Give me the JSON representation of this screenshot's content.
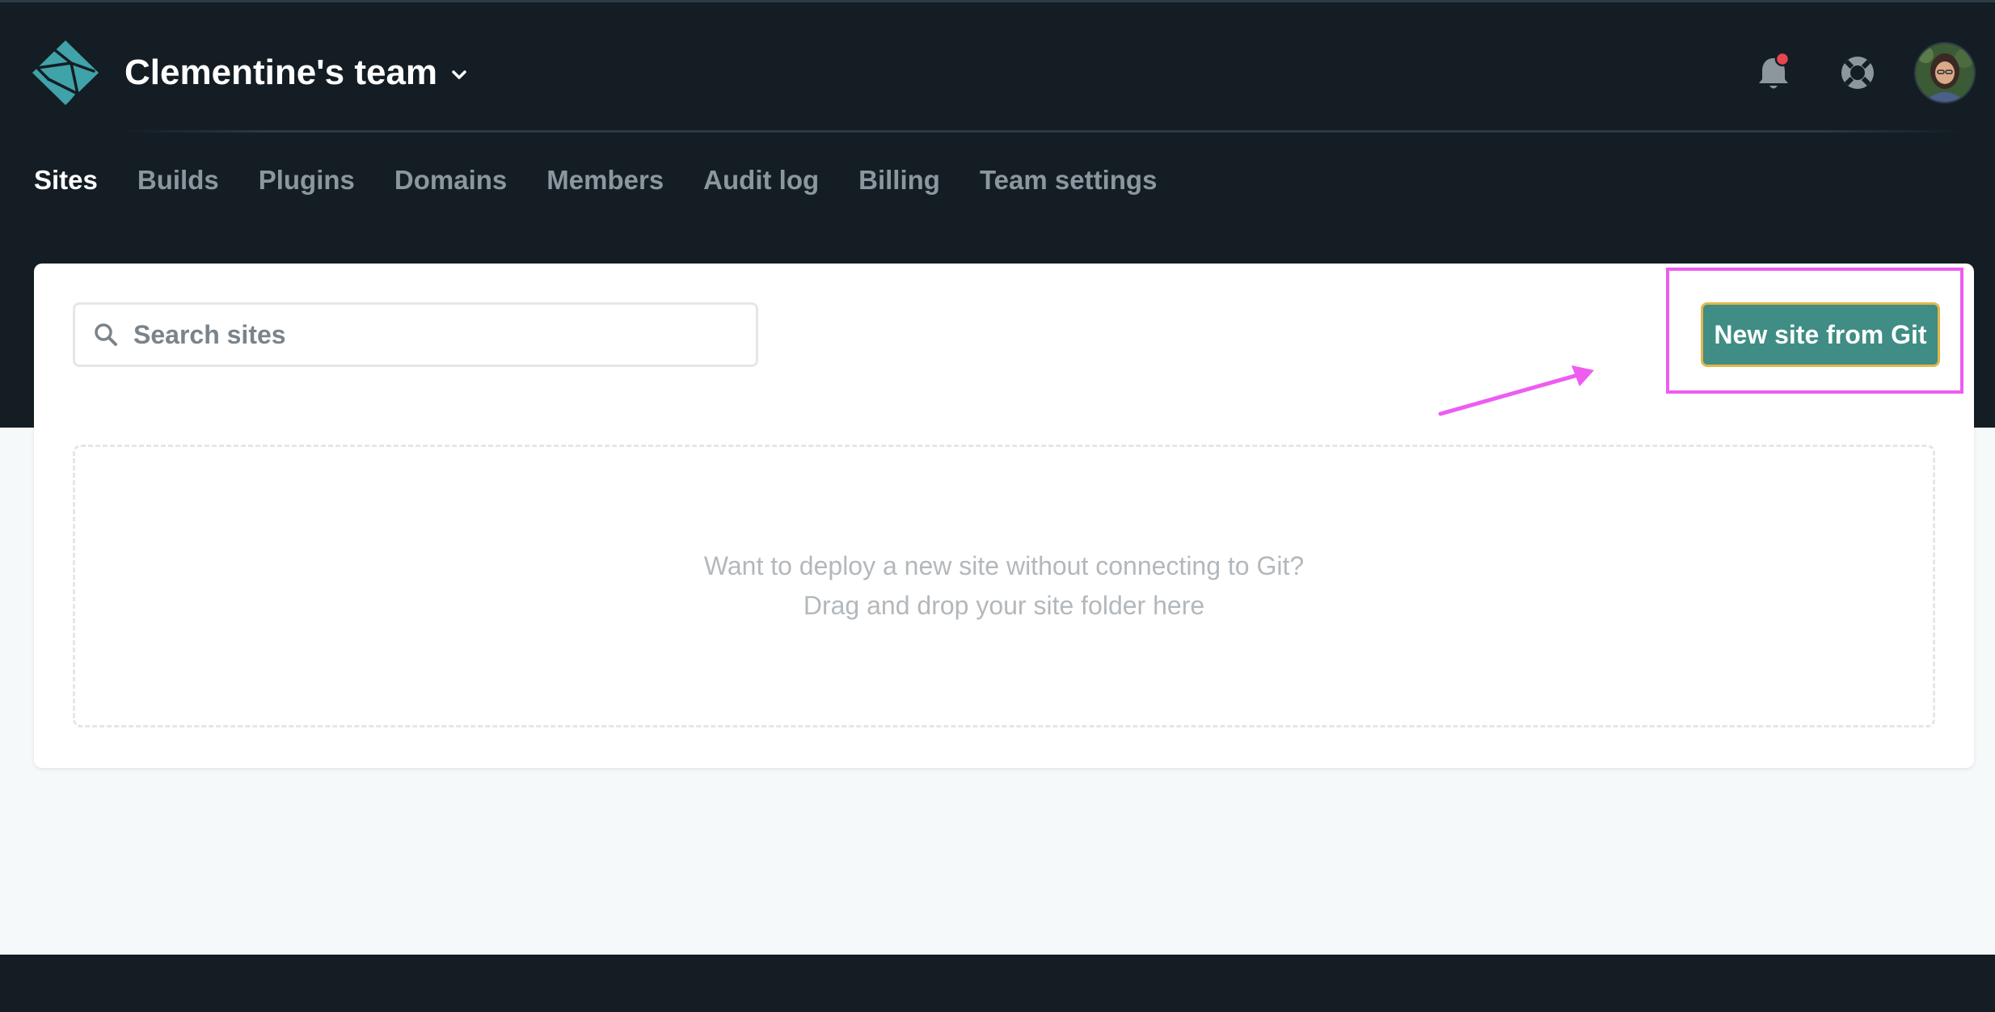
{
  "colors": {
    "header_bg": "#141d24",
    "page_bg": "#f6f9f9",
    "accent_button": "#3f8d84",
    "button_border": "#e2b64b",
    "annotation": "#ee5cf0",
    "notification_dot": "#e8464f"
  },
  "header": {
    "team_name": "Clementine's team",
    "team_chevron_icon": "chevron-down-icon",
    "logo_icon": "netlify-logo-icon",
    "notification_icon": "bell-icon",
    "notification_has_unread": true,
    "help_icon": "lifebuoy-icon",
    "avatar_icon": "user-avatar"
  },
  "nav": {
    "items": [
      {
        "label": "Sites",
        "active": true
      },
      {
        "label": "Builds",
        "active": false
      },
      {
        "label": "Plugins",
        "active": false
      },
      {
        "label": "Domains",
        "active": false
      },
      {
        "label": "Members",
        "active": false
      },
      {
        "label": "Audit log",
        "active": false
      },
      {
        "label": "Billing",
        "active": false
      },
      {
        "label": "Team settings",
        "active": false
      }
    ]
  },
  "sites": {
    "search": {
      "icon": "search-icon",
      "placeholder": "Search sites",
      "value": ""
    },
    "new_site_button": "New site from Git",
    "dropzone": {
      "line1": "Want to deploy a new site without connecting to Git?",
      "line2": "Drag and drop your site folder here"
    }
  },
  "annotations": {
    "highlight": "new-site-button",
    "arrow_icon": "annotation-arrow"
  }
}
